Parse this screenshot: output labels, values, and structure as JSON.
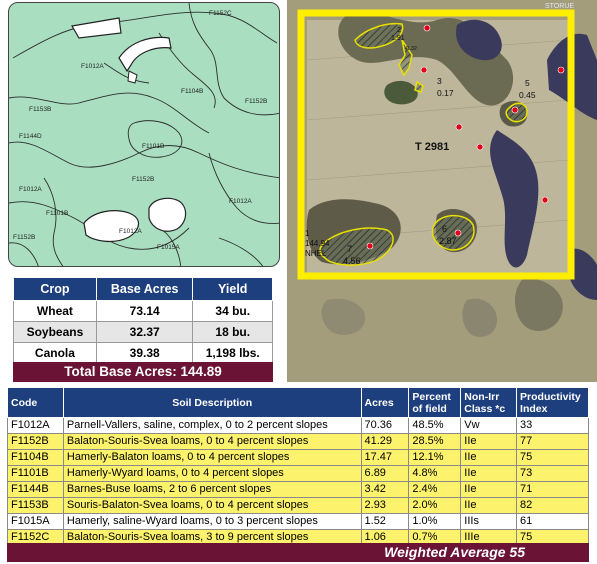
{
  "soil_map": {
    "labels": [
      "F1152C",
      "F1012A",
      "F1104B",
      "F1152B",
      "F1153B",
      "F1144D",
      "F1101B",
      "F1152B",
      "F1012A",
      "F1101B",
      "F1012A",
      "F1012A",
      "F1152B",
      "F1015A"
    ]
  },
  "aerial": {
    "corner_text": "STORUE",
    "tract_label": "T 2981",
    "side_labels": [
      "1",
      "144.94",
      "NHEL"
    ],
    "fields": [
      {
        "id": "2",
        "acres": "1.91"
      },
      {
        "id": "4",
        "acres": "1.32"
      },
      {
        "id": "3",
        "acres": "0.17"
      },
      {
        "id": "5",
        "acres": "0.45"
      },
      {
        "id": "6",
        "acres": "2.87"
      },
      {
        "id": "7",
        "acres": "4.56"
      }
    ]
  },
  "crop_table": {
    "headers": [
      "Crop",
      "Base Acres",
      "Yield"
    ],
    "rows": [
      {
        "crop": "Wheat",
        "base_acres": "73.14",
        "yield": "34 bu."
      },
      {
        "crop": "Soybeans",
        "base_acres": "32.37",
        "yield": "18 bu."
      },
      {
        "crop": "Canola",
        "base_acres": "39.38",
        "yield": "1,198 lbs."
      }
    ],
    "total": "Total Base Acres: 144.89"
  },
  "soil_table": {
    "headers": {
      "code": "Code",
      "description": "Soil Description",
      "acres": "Acres",
      "percent": "Percent of field",
      "class": "Non-Irr Class *c",
      "index": "Productivity Index"
    },
    "rows": [
      {
        "code": "F1012A",
        "description": "Parnell-Vallers, saline, complex, 0 to 2 percent slopes",
        "acres": "70.36",
        "percent": "48.5%",
        "class": "Vw",
        "index": "33"
      },
      {
        "code": "F1152B",
        "description": "Balaton-Souris-Svea loams, 0 to 4 percent slopes",
        "acres": "41.29",
        "percent": "28.5%",
        "class": "IIe",
        "index": "77"
      },
      {
        "code": "F1104B",
        "description": "Hamerly-Balaton loams, 0 to 4 percent slopes",
        "acres": "17.47",
        "percent": "12.1%",
        "class": "IIe",
        "index": "75"
      },
      {
        "code": "F1101B",
        "description": "Hamerly-Wyard loams, 0 to 4 percent slopes",
        "acres": "6.89",
        "percent": "4.8%",
        "class": "IIe",
        "index": "73"
      },
      {
        "code": "F1144B",
        "description": "Barnes-Buse loams, 2 to 6 percent slopes",
        "acres": "3.42",
        "percent": "2.4%",
        "class": "IIe",
        "index": "71"
      },
      {
        "code": "F1153B",
        "description": "Souris-Balaton-Svea loams, 0 to 4 percent slopes",
        "acres": "2.93",
        "percent": "2.0%",
        "class": "IIe",
        "index": "82"
      },
      {
        "code": "F1015A",
        "description": "Hamerly, saline-Wyard loams, 0 to 3 percent slopes",
        "acres": "1.52",
        "percent": "1.0%",
        "class": "IIIs",
        "index": "61"
      },
      {
        "code": "F1152C",
        "description": "Balaton-Souris-Svea loams, 3 to 9 percent slopes",
        "acres": "1.06",
        "percent": "0.7%",
        "class": "IIIe",
        "index": "75"
      }
    ],
    "weighted_average": "Weighted Average 55"
  },
  "colors": {
    "header_blue": "#1d3f7d",
    "maroon": "#6b1335",
    "highlight_yellow": "#fcf26b",
    "map_green": "#a9dfc0",
    "frame_yellow": "#ffee00"
  }
}
